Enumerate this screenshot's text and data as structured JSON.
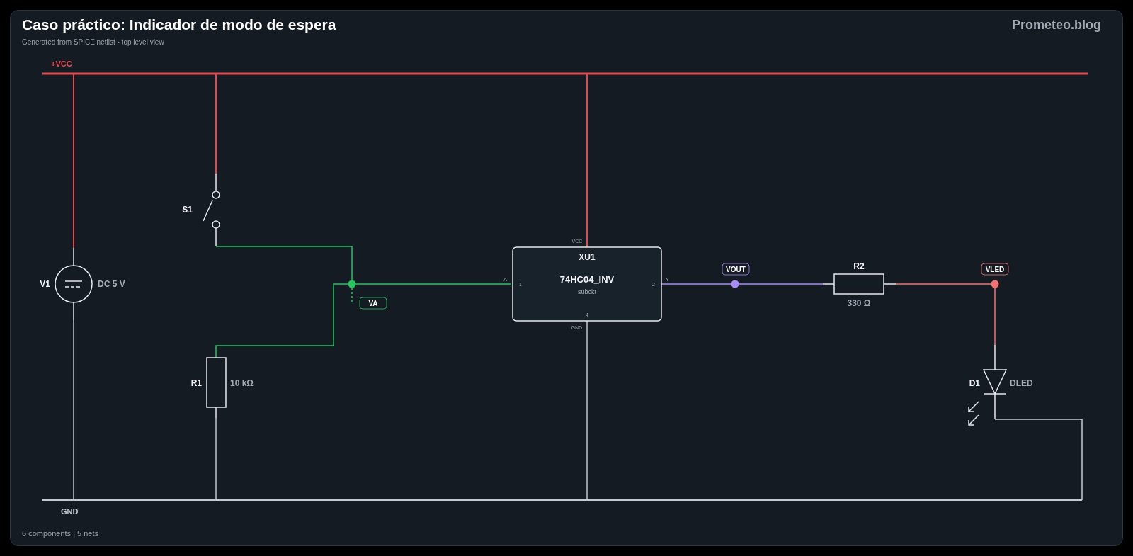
{
  "header": {
    "title": "Caso práctico: Indicador de modo de espera",
    "subtitle": "Generated from SPICE netlist - top level view",
    "brand": "Prometeo.blog"
  },
  "nets": [
    {
      "name": "+VCC",
      "color": "#e5484d"
    },
    {
      "name": "GND",
      "color": "#c3c9d1"
    },
    {
      "name": "VA",
      "color": "#22c55e"
    },
    {
      "name": "VOUT",
      "color": "#a78bfa"
    },
    {
      "name": "VLED",
      "color": "#f87171"
    }
  ],
  "components": [
    {
      "kind": "vsource",
      "ref": "V1",
      "value": "DC 5 V"
    },
    {
      "kind": "switch",
      "ref": "S1"
    },
    {
      "kind": "resistor",
      "ref": "R1",
      "value": "10 kΩ"
    },
    {
      "kind": "subckt",
      "ref": "XU1",
      "value": "74HC04_INV",
      "type": "subckt",
      "pins": [
        {
          "name": "A",
          "number": "1"
        },
        {
          "name": "Y",
          "number": "2"
        },
        {
          "name": "VCC"
        },
        {
          "name": "GND",
          "number": "4"
        }
      ]
    },
    {
      "kind": "resistor",
      "ref": "R2",
      "value": "330 Ω"
    },
    {
      "kind": "led",
      "ref": "D1",
      "value": "DLED"
    }
  ],
  "footer": "6 components | 5 nets"
}
